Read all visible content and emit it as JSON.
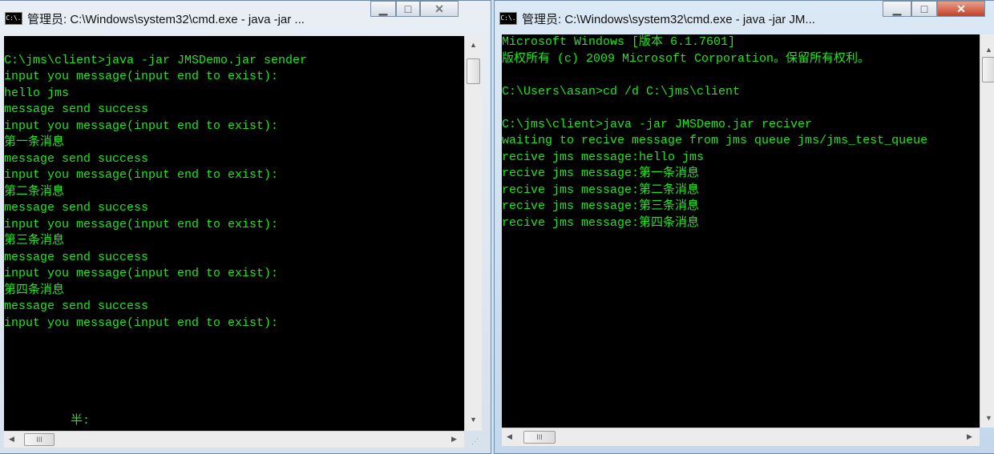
{
  "left": {
    "title": "管理员: C:\\Windows\\system32\\cmd.exe - java  -jar ...",
    "icon_label": "C:\\.",
    "lines": [
      "",
      "C:\\jms\\client>java -jar JMSDemo.jar sender",
      "input you message(input end to exist):",
      "hello jms",
      "message send success",
      "input you message(input end to exist):",
      "第一条消息",
      "message send success",
      "input you message(input end to exist):",
      "第二条消息",
      "message send success",
      "input you message(input end to exist):",
      "第三条消息",
      "message send success",
      "input you message(input end to exist):",
      "第四条消息",
      "message send success",
      "input you message(input end to exist):"
    ],
    "ime_status": "半:"
  },
  "right": {
    "title": "管理员: C:\\Windows\\system32\\cmd.exe - java  -jar JM...",
    "icon_label": "C:\\.",
    "lines": [
      "Microsoft Windows [版本 6.1.7601]",
      "版权所有 (c) 2009 Microsoft Corporation。保留所有权利。",
      "",
      "C:\\Users\\asan>cd /d C:\\jms\\client",
      "",
      "C:\\jms\\client>java -jar JMSDemo.jar reciver",
      "waiting to recive message from jms queue jms/jms_test_queue",
      "recive jms message:hello jms",
      "recive jms message:第一条消息",
      "recive jms message:第二条消息",
      "recive jms message:第三条消息",
      "recive jms message:第四条消息"
    ]
  },
  "scroll_thumb_grip": "III"
}
